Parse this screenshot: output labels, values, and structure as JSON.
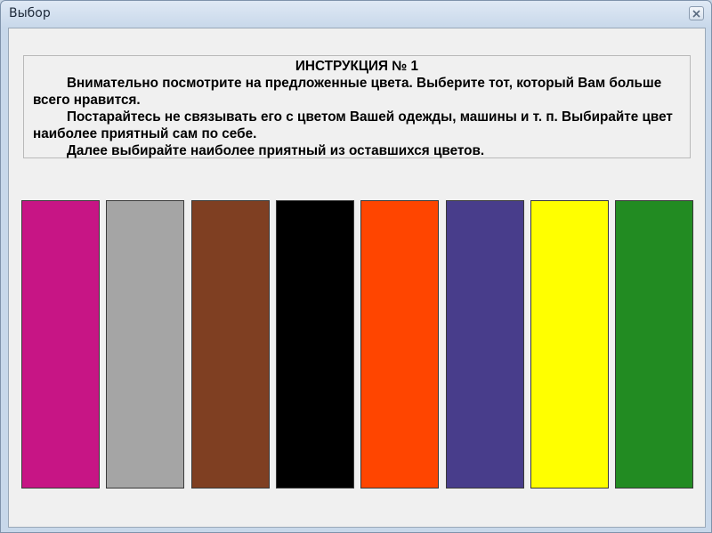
{
  "window": {
    "title": "Выбор"
  },
  "instruction": {
    "title": "ИНСТРУКЦИЯ № 1",
    "paragraphs": [
      "Внимательно посмотрите на предложенные цвета. Выберите тот, который Вам больше всего нравится.",
      "Постарайтесь не связывать его с цветом Вашей одежды, машины и т. п. Выбирайте цвет наиболее приятный сам по себе.",
      "Далее выбирайте наиболее приятный из оставшихся цветов."
    ]
  },
  "swatches": [
    {
      "name": "magenta",
      "color": "#c71585"
    },
    {
      "name": "gray",
      "color": "#a5a5a5"
    },
    {
      "name": "brown",
      "color": "#7f3f22"
    },
    {
      "name": "black",
      "color": "#000000"
    },
    {
      "name": "orange-red",
      "color": "#ff4500"
    },
    {
      "name": "dark-slate-blue",
      "color": "#483d8b"
    },
    {
      "name": "yellow",
      "color": "#ffff00"
    },
    {
      "name": "green",
      "color": "#228b22"
    }
  ],
  "icons": {
    "close": "close-icon"
  }
}
